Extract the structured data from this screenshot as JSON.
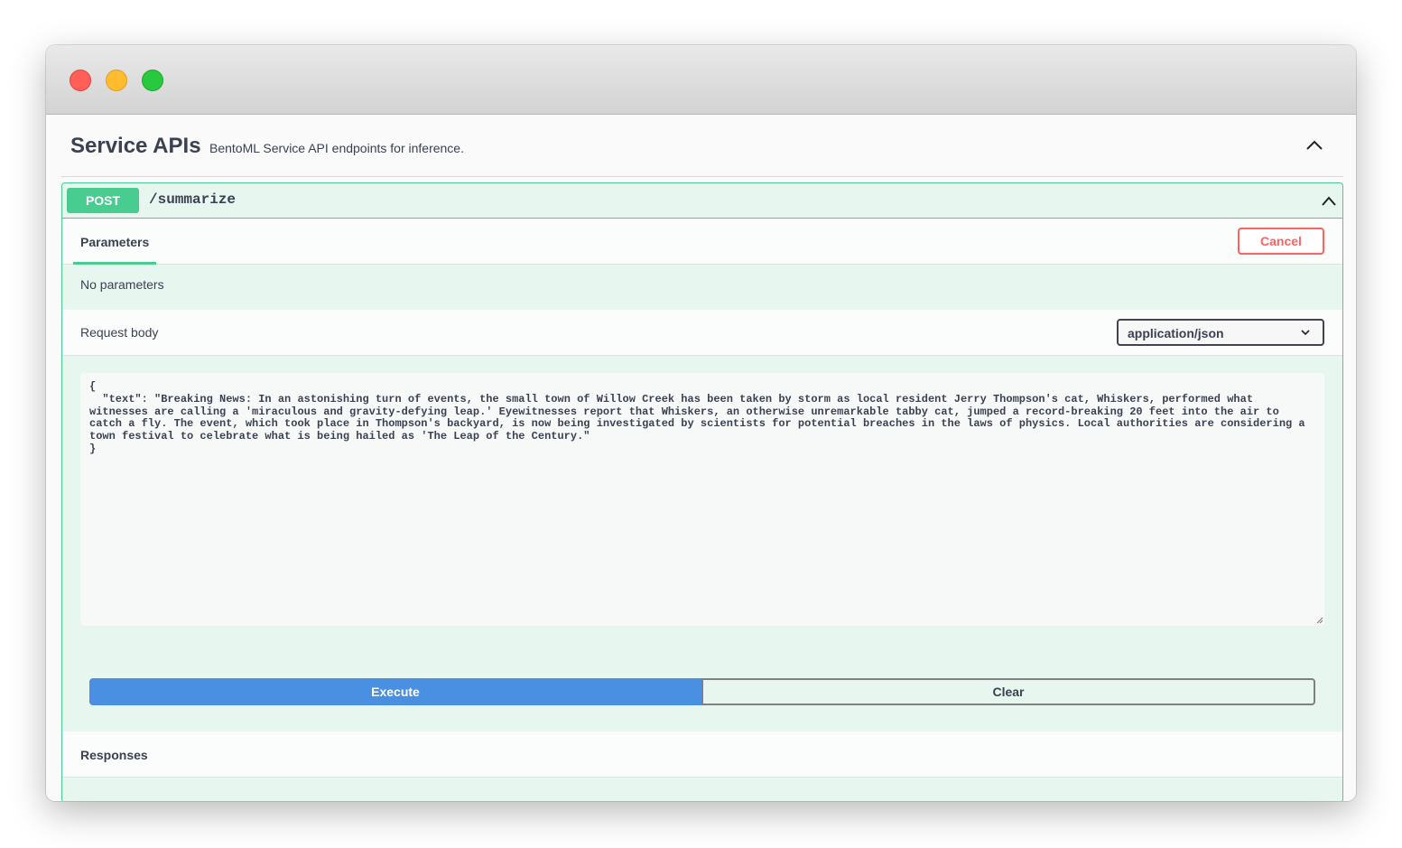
{
  "section": {
    "title": "Service APIs",
    "description": "BentoML Service API endpoints for inference.",
    "collapse_icon": "chevron-up-icon"
  },
  "operation": {
    "method": "POST",
    "path": "/summarize",
    "collapse_icon": "chevron-up-icon",
    "method_color": "#49cc90"
  },
  "parameters": {
    "tab_label": "Parameters",
    "cancel_label": "Cancel",
    "empty_text": "No parameters"
  },
  "request_body": {
    "title": "Request body",
    "content_type": "application/json",
    "body": "{\n  \"text\": \"Breaking News: In an astonishing turn of events, the small town of Willow Creek has been taken by storm as local resident Jerry Thompson's cat, Whiskers, performed what witnesses are calling a 'miraculous and gravity-defying leap.' Eyewitnesses report that Whiskers, an otherwise unremarkable tabby cat, jumped a record-breaking 20 feet into the air to catch a fly. The event, which took place in Thompson's backyard, is now being investigated by scientists for potential breaches in the laws of physics. Local authorities are considering a town festival to celebrate what is being hailed as 'The Leap of the Century.\"\n}"
  },
  "actions": {
    "execute_label": "Execute",
    "clear_label": "Clear",
    "execute_color": "#4990e2"
  },
  "responses": {
    "title": "Responses"
  }
}
